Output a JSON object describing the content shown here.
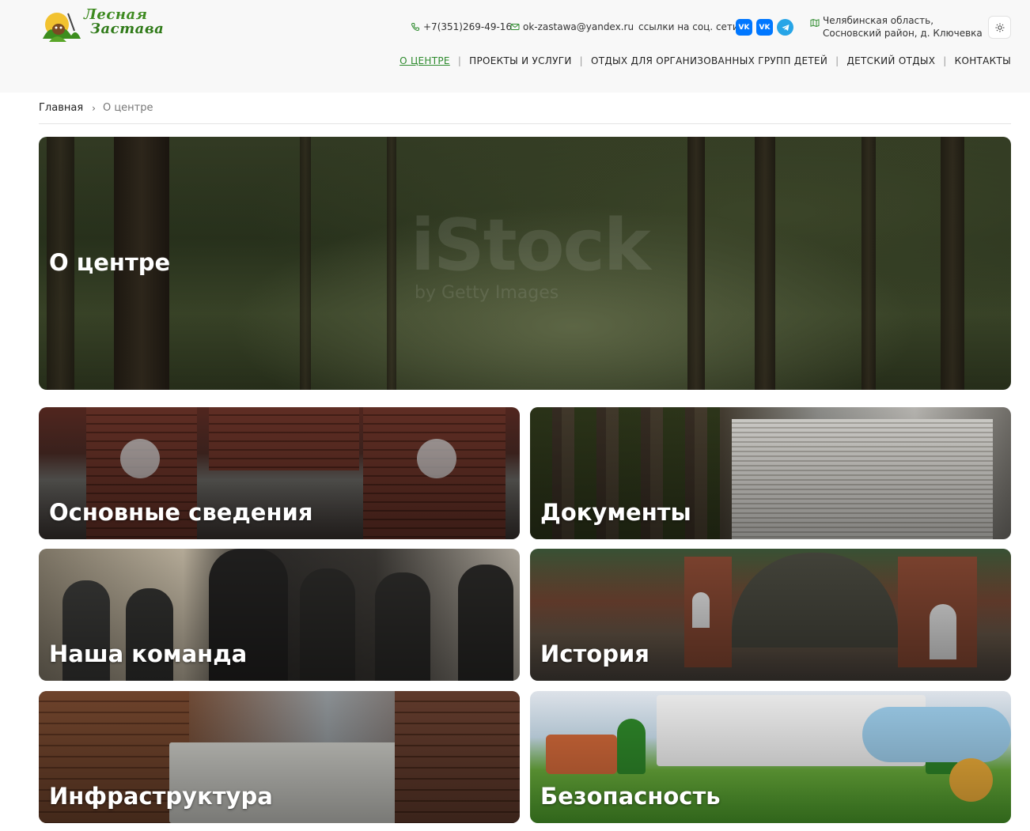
{
  "header": {
    "logo": {
      "line1": "Лесная",
      "line2": "Застава"
    },
    "phone": "+7(351)269-49-16",
    "email": "ok-zastawa@yandex.ru",
    "social_label": "ссылки на соц. сети:",
    "social": [
      {
        "name": "vk-icon",
        "label": "VK"
      },
      {
        "name": "vk-icon",
        "label": "VK"
      },
      {
        "name": "telegram-icon",
        "label": ""
      }
    ],
    "address_line1": "Челябинская область,",
    "address_line2": "Сосновский район, д. Ключевка"
  },
  "nav": {
    "items": [
      {
        "label": "О ЦЕНТРЕ",
        "active": true
      },
      {
        "label": "ПРОЕКТЫ И УСЛУГИ"
      },
      {
        "label": "ОТДЫХ ДЛЯ ОРГАНИЗОВАННЫХ ГРУПП ДЕТЕЙ"
      },
      {
        "label": "ДЕТСКИЙ ОТДЫХ"
      },
      {
        "label": "КОНТАКТЫ"
      }
    ],
    "separator": "|"
  },
  "breadcrumb": {
    "home": "Главная",
    "current": "О центре"
  },
  "hero": {
    "title": "О центре",
    "watermark": "iStock",
    "watermark_sub": "by Getty Images"
  },
  "tiles": [
    {
      "title": "Основные сведения"
    },
    {
      "title": "Документы"
    },
    {
      "title": "Наша команда"
    },
    {
      "title": "История"
    },
    {
      "title": "Инфраструктура"
    },
    {
      "title": "Безопасность"
    }
  ],
  "colors": {
    "accent": "#2e8b2e",
    "header_bg": "#f8f8f8",
    "vk": "#0077ff",
    "telegram": "#27a5e7"
  }
}
